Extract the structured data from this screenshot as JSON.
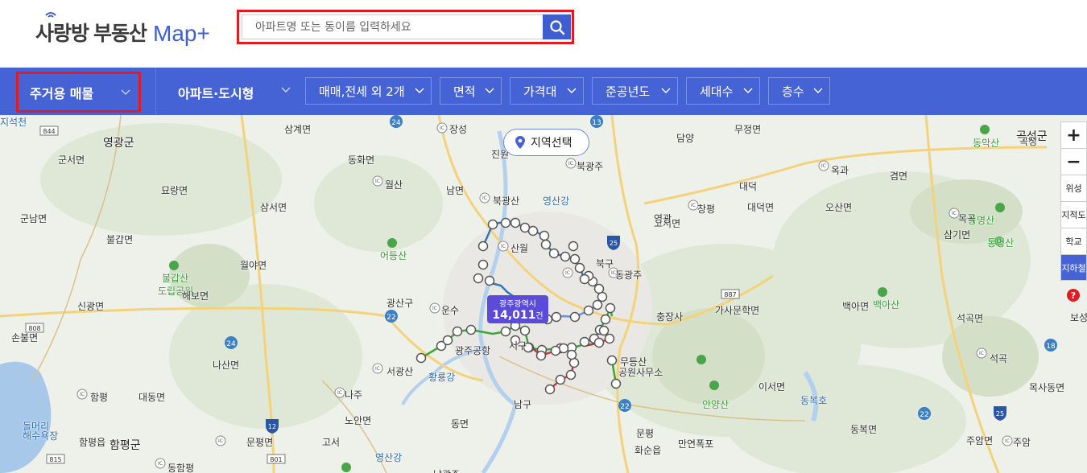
{
  "header": {
    "logo_name_dark": "사랑방",
    "logo_name_blue": "부동산",
    "logo_map": "Map+",
    "search_placeholder": "아파트명 또는 동이름 입력하세요"
  },
  "filters": {
    "type_label": "주거용 매물",
    "kind_label": "아파트·도시형",
    "chips": [
      {
        "label": "매매,전세 외 2개"
      },
      {
        "label": "면적"
      },
      {
        "label": "가격대"
      },
      {
        "label": "준공년도"
      },
      {
        "label": "세대수"
      },
      {
        "label": "층수"
      }
    ]
  },
  "map": {
    "region_button": "지역선택",
    "city_name": "광주광역시",
    "city_count": "14,011",
    "city_count_unit": "건",
    "controls": {
      "zoom_in": "+",
      "zoom_out": "−",
      "satellite": "위성",
      "cadastral": "지적도",
      "school": "학교",
      "subway": "지하철",
      "help": "?"
    },
    "places": [
      {
        "text": "영광군",
        "cls": "big"
      },
      {
        "text": "삼계면"
      },
      {
        "text": "장성"
      },
      {
        "text": "진원"
      },
      {
        "text": "무정면"
      },
      {
        "text": "곡성군",
        "cls": "big"
      },
      {
        "text": "군서면"
      },
      {
        "text": "동화면"
      },
      {
        "text": "월산"
      },
      {
        "text": "남면"
      },
      {
        "text": "북광산"
      },
      {
        "text": "영산강",
        "cls": "blue"
      },
      {
        "text": "대덕면"
      },
      {
        "text": "오산면"
      },
      {
        "text": "겸면"
      },
      {
        "text": "묘량면"
      },
      {
        "text": "삼서면"
      },
      {
        "text": "군남면"
      },
      {
        "text": "불갑면"
      },
      {
        "text": "월야면"
      },
      {
        "text": "어등산",
        "cls": "green"
      },
      {
        "text": "산월"
      },
      {
        "text": "북구"
      },
      {
        "text": "동광주"
      },
      {
        "text": "고서면"
      },
      {
        "text": "삼기면"
      },
      {
        "text": "불갑산",
        "cls": "green"
      },
      {
        "text": "도립공원",
        "cls": "green"
      },
      {
        "text": "해보면"
      },
      {
        "text": "신광면"
      },
      {
        "text": "광산구"
      },
      {
        "text": "운수"
      },
      {
        "text": "충장사"
      },
      {
        "text": "가사문학면"
      },
      {
        "text": "백아면"
      },
      {
        "text": "백아산",
        "cls": "green"
      },
      {
        "text": "석곡면"
      },
      {
        "text": "손불면"
      },
      {
        "text": "광주공항"
      },
      {
        "text": "서구"
      },
      {
        "text": "무등산"
      },
      {
        "text": "공원사무소"
      },
      {
        "text": "석곡"
      },
      {
        "text": "나산면"
      },
      {
        "text": "서광산"
      },
      {
        "text": "황룡강",
        "cls": "blue"
      },
      {
        "text": "이서면"
      },
      {
        "text": "대동면"
      },
      {
        "text": "함평"
      },
      {
        "text": "나주"
      },
      {
        "text": "남구"
      },
      {
        "text": "동복호",
        "cls": "blue"
      },
      {
        "text": "목사동면"
      },
      {
        "text": "노안면"
      },
      {
        "text": "동면"
      },
      {
        "text": "안양산",
        "cls": "green"
      },
      {
        "text": "동복면"
      },
      {
        "text": "함평읍"
      },
      {
        "text": "함평군",
        "cls": "big"
      },
      {
        "text": "문평면"
      },
      {
        "text": "화순읍"
      },
      {
        "text": "만연폭포"
      },
      {
        "text": "주암면"
      },
      {
        "text": "주암"
      },
      {
        "text": "동함평"
      },
      {
        "text": "영산강",
        "cls": "blue"
      },
      {
        "text": "돌머리",
        "cls": "blue"
      },
      {
        "text": "해수욕장",
        "cls": "blue"
      },
      {
        "text": "동악산",
        "cls": "green"
      },
      {
        "text": "통명산",
        "cls": "green"
      },
      {
        "text": "통명산",
        "cls": "green"
      },
      {
        "text": "목곡"
      },
      {
        "text": "보성"
      },
      {
        "text": "곡성"
      },
      {
        "text": "담양"
      },
      {
        "text": "북광주"
      },
      {
        "text": "대덕"
      },
      {
        "text": "창평"
      },
      {
        "text": "옥과"
      },
      {
        "text": "영광"
      },
      {
        "text": "고서"
      },
      {
        "text": "문평"
      },
      {
        "text": "남광주"
      },
      {
        "text": "지석천",
        "cls": "blue"
      }
    ]
  }
}
